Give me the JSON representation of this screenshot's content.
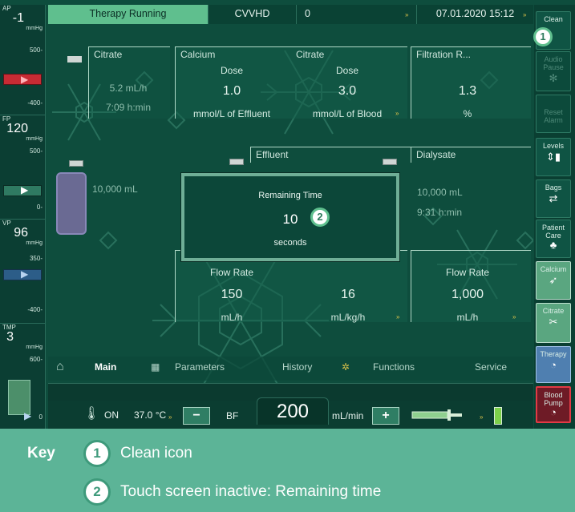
{
  "topbar": {
    "status": "Therapy Running",
    "mode": "CVVHD",
    "count": "0",
    "datetime": "07.01.2020 15:12"
  },
  "pressures": {
    "ap": {
      "label": "AP",
      "value": "-1",
      "unit": "mmHg",
      "tick_high": "500-",
      "tick_low": "-400-"
    },
    "fp": {
      "label": "FP",
      "value": "120",
      "unit": "mmHg",
      "tick_high": "500-",
      "tick_low": "0-"
    },
    "vp": {
      "label": "VP",
      "value": "96",
      "unit": "mmHg",
      "tick_high": "350-",
      "tick_low": "-400-"
    },
    "tmp": {
      "label": "TMP",
      "value": "3",
      "unit": "mmHg",
      "tick_high": "600-",
      "tick_low": "0"
    }
  },
  "right_buttons": {
    "clean": "Clean",
    "audio_pause": "Audio Pause",
    "reset_alarm": "Reset Alarm",
    "levels": "Levels",
    "bags": "Bags",
    "patient_care": "Patient Care",
    "calcium": "Calcium",
    "citrate": "Citrate",
    "therapy": "Therapy",
    "blood_pump": "Blood Pump"
  },
  "panels": {
    "citrate_left": {
      "title": "Citrate",
      "line1": "5.2 mL/h",
      "line2": "7:09 h:min"
    },
    "calcium": {
      "title": "Calcium",
      "dose_label": "Dose",
      "dose": "1.0",
      "unit": "mmol/L of Effluent"
    },
    "citrate": {
      "title": "Citrate",
      "dose_label": "Dose",
      "dose": "3.0",
      "unit": "mmol/L of Blood"
    },
    "filtration": {
      "title": "Filtration R...",
      "value": "1.3",
      "unit": "%"
    },
    "effluent": {
      "title": "Effluent",
      "bag_volume": "10,000 mL"
    },
    "dialysate": {
      "title": "Dialysate",
      "line1": "10,000 mL",
      "line2": "9:31 h:min"
    },
    "effluent_flow": {
      "label": "Flow Rate",
      "value": "150",
      "unit": "mL/h",
      "value2": "16",
      "unit2": "mL/kg/h"
    },
    "dialysate_flow": {
      "label": "Flow Rate",
      "value": "1,000",
      "unit": "mL/h"
    }
  },
  "nav": {
    "main": "Main",
    "parameters": "Parameters",
    "history": "History",
    "functions": "Functions",
    "service": "Service"
  },
  "bottom": {
    "heater_state": "ON",
    "temperature": "37.0 °C",
    "bf_label": "BF",
    "bf_value": "200",
    "bf_unit": "mL/min",
    "minus": "−",
    "plus": "+"
  },
  "modal": {
    "title": "Remaining Time",
    "value": "10",
    "unit": "seconds"
  },
  "callouts": [
    "1",
    "2"
  ],
  "key": {
    "heading": "Key",
    "items": [
      {
        "num": "1",
        "text": "Clean icon"
      },
      {
        "num": "2",
        "text": "Touch screen inactive: Remaining time"
      }
    ]
  },
  "colors": {
    "screen_bg": "#0e4d3d",
    "status_green": "#5fbf8e",
    "key_bg": "#5cb497",
    "alarm_red": "#c72b34",
    "therapy_blue": "#4f7fb0"
  }
}
